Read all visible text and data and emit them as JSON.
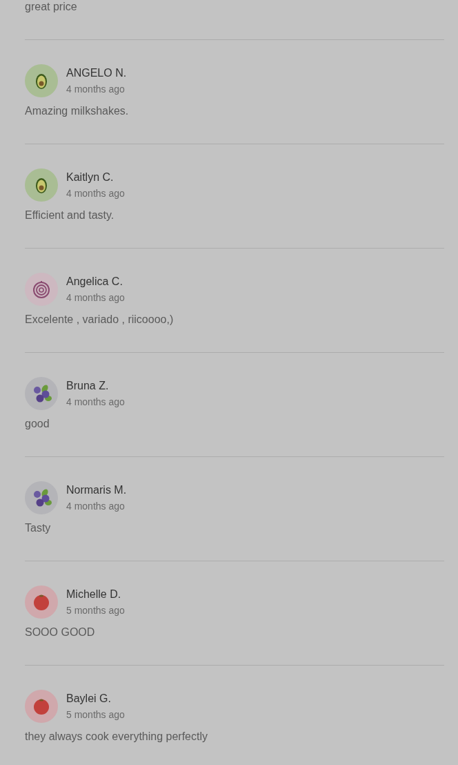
{
  "previous_review": {
    "text": "great price"
  },
  "reviews": [
    {
      "name": "ANGELO N.",
      "time": "4 months ago",
      "text": "Amazing milkshakes.",
      "kind": "avocado"
    },
    {
      "name": "Kaitlyn C.",
      "time": "4 months ago",
      "text": "Efficient and tasty.",
      "kind": "avocado"
    },
    {
      "name": "Angelica C.",
      "time": "4 months ago",
      "text": "Excelente , variado , riicoooo,)",
      "kind": "onion"
    },
    {
      "name": "Bruna Z.",
      "time": "4 months ago",
      "text": "good",
      "kind": "blueberry"
    },
    {
      "name": "Normaris M.",
      "time": "4 months ago",
      "text": "Tasty",
      "kind": "blueberry"
    },
    {
      "name": "Michelle D.",
      "time": "5 months ago",
      "text": "SOOO GOOD",
      "kind": "tomato"
    },
    {
      "name": "Baylei G.",
      "time": "5 months ago",
      "text": "they always cook everything perfectly",
      "kind": "tomato"
    }
  ]
}
